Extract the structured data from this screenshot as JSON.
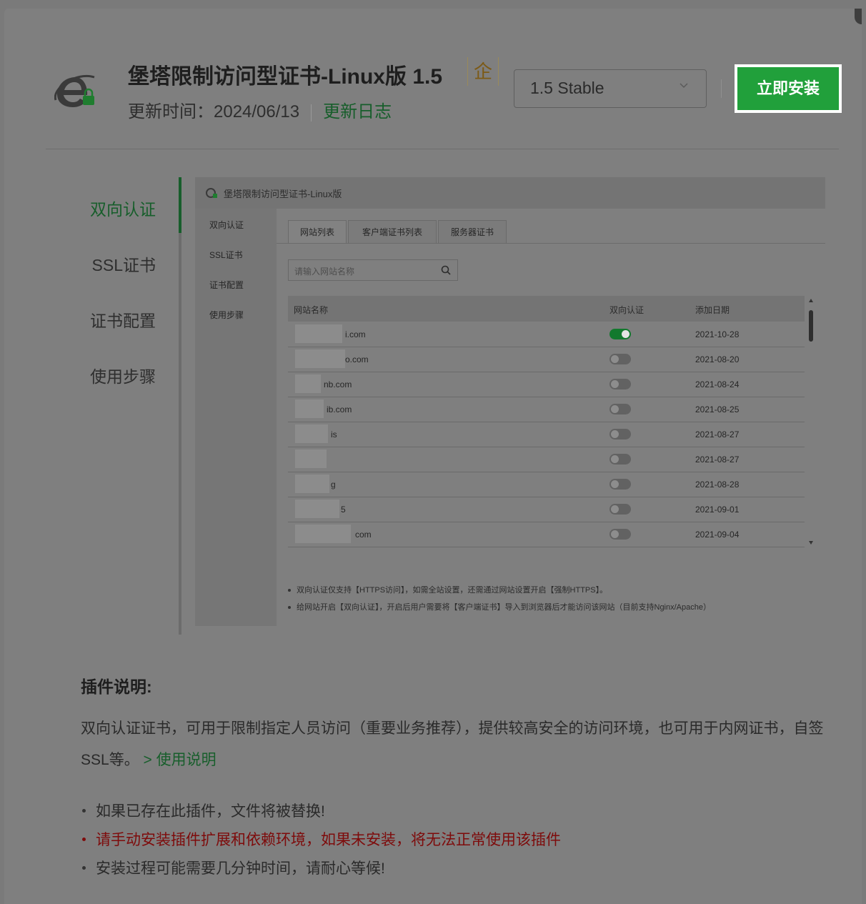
{
  "header": {
    "title": "堡塔限制访问型证书-Linux版 1.5",
    "enterprise_badge": "企",
    "update_label": "更新时间：2024/06/13",
    "changelog_link": "更新日志",
    "version_selected": "1.5 Stable",
    "install_button": "立即安装"
  },
  "side_tabs": [
    {
      "label": "双向认证",
      "active": true
    },
    {
      "label": "SSL证书",
      "active": false
    },
    {
      "label": "证书配置",
      "active": false
    },
    {
      "label": "使用步骤",
      "active": false
    }
  ],
  "preview": {
    "header_title": "堡塔限制访问型证书-Linux版",
    "side_items": [
      "双向认证",
      "SSL证书",
      "证书配置",
      "使用步骤"
    ],
    "tabs": [
      "网站列表",
      "客户端证书列表",
      "服务器证书"
    ],
    "search_placeholder": "请输入网站名称",
    "columns": [
      "网站名称",
      "双向认证",
      "添加日期"
    ],
    "rows": [
      {
        "name": "i.com",
        "enabled": true,
        "date": "2021-10-28"
      },
      {
        "name": "o.com",
        "enabled": false,
        "date": "2021-08-20"
      },
      {
        "name": "nb.com",
        "enabled": false,
        "date": "2021-08-24"
      },
      {
        "name": "ib.com",
        "enabled": false,
        "date": "2021-08-25"
      },
      {
        "name": "is",
        "enabled": false,
        "date": "2021-08-27"
      },
      {
        "name": "",
        "enabled": false,
        "date": "2021-08-27"
      },
      {
        "name": "g",
        "enabled": false,
        "date": "2021-08-28"
      },
      {
        "name": "5",
        "enabled": false,
        "date": "2021-09-01"
      },
      {
        "name": "com",
        "enabled": false,
        "date": "2021-09-04"
      }
    ],
    "notes": [
      "双向认证仅支持【HTTPS访问】，如需全站设置，还需通过网站设置开启【强制HTTPS】。",
      "给网站开启【双向认证】，开启后用户需要将【客户端证书】导入到浏览器后才能访问该网站（目前支持Nginx/Apache）"
    ]
  },
  "description": {
    "title": "插件说明:",
    "body": "双向认证证书，可用于限制指定人员访问（重要业务推荐），提供较高安全的访问环境，也可用于内网证书，自签SSL等。",
    "link": "> 使用说明"
  },
  "notes": [
    {
      "text": "如果已存在此插件，文件将被替换!",
      "warn": false
    },
    {
      "text": "请手动安装插件扩展和依赖环境，如果未安装，将无法正常使用该插件",
      "warn": true
    },
    {
      "text": "安装过程可能需要几分钟时间，请耐心等候!",
      "warn": false
    }
  ],
  "colors": {
    "accent": "#20a53a",
    "warn": "#cc0000",
    "overlay": "#7f7f7f"
  }
}
